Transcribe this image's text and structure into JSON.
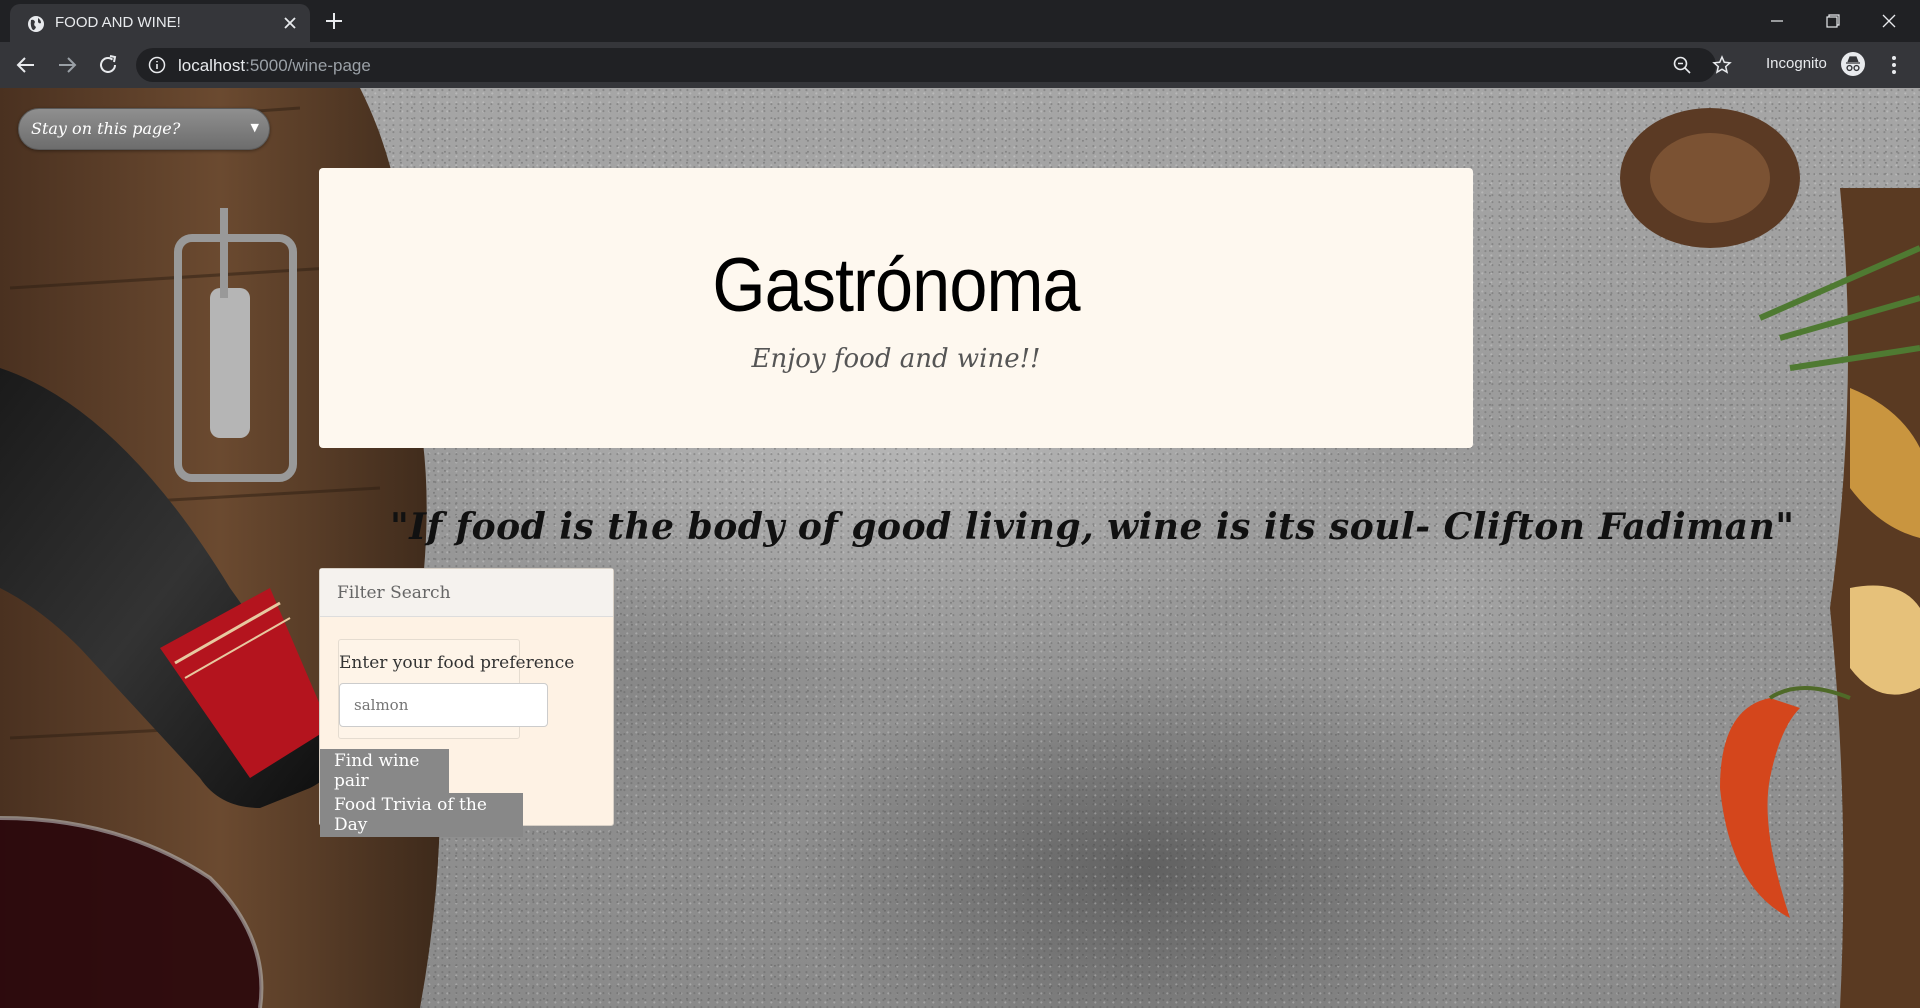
{
  "browser": {
    "tab_title": "FOOD AND WINE!",
    "url_host": "localhost",
    "url_path": ":5000/wine-page",
    "profile_label": "Incognito",
    "icons": [
      "globe-icon",
      "close-icon",
      "plus-icon",
      "minimize-icon",
      "restore-icon",
      "close-window-icon",
      "back-icon",
      "forward-icon",
      "reload-icon",
      "info-icon",
      "zoom-icon",
      "star-icon",
      "incognito-icon",
      "kebab-menu-icon"
    ]
  },
  "page": {
    "stay_select": {
      "value": "Stay on this page?"
    },
    "header": {
      "title": "Gastrónoma",
      "subtitle": "Enjoy food and wine!!"
    },
    "quote": "\"If food is the body of good living, wine is its soul- Clifton Fadiman\"",
    "filter": {
      "header_label": "Filter Search",
      "pref_label": "Enter your food preference",
      "pref_placeholder": "salmon",
      "find_button": "Find wine pair",
      "trivia_button": "Food Trivia of the Day"
    },
    "colors": {
      "card_bg": "#fef8ef",
      "panel_bg": "#fef2e4",
      "button_bg": "#888888"
    }
  }
}
